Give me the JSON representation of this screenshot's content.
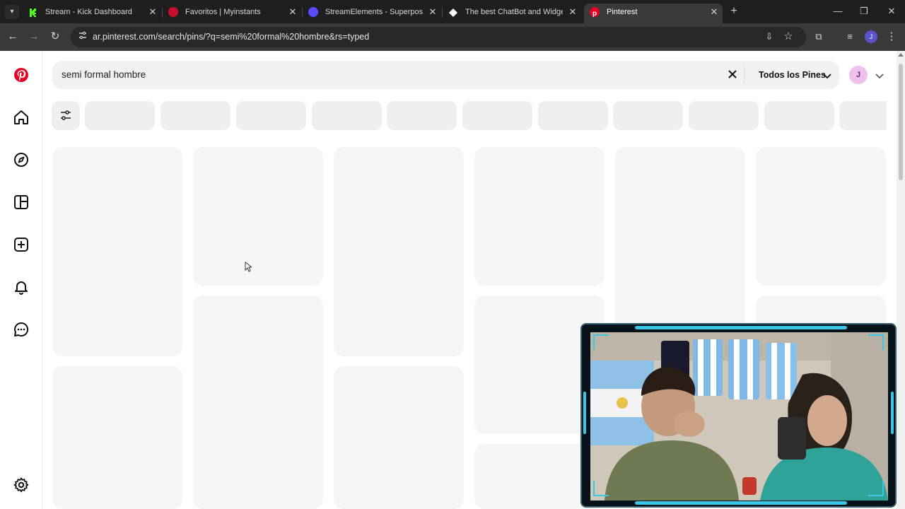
{
  "browser": {
    "tabs": [
      {
        "title": "Stream - Kick Dashboard",
        "favicon_color": "#53fc18",
        "favicon": "kick-logo-icon"
      },
      {
        "title": "Favoritos | Myinstants",
        "favicon_color": "#c8102e",
        "favicon": "myinstants-logo-icon"
      },
      {
        "title": "StreamElements - Superposición",
        "favicon_color": "#5b4bff",
        "favicon": "streamelements-logo-icon"
      },
      {
        "title": "The best ChatBot and Widgets",
        "favicon_color": "#ffffff",
        "favicon": "chatbot-logo-icon"
      },
      {
        "title": "Pinterest",
        "favicon_color": "#e60023",
        "favicon": "pinterest-logo-icon"
      }
    ],
    "active_tab_index": 4,
    "url": "ar.pinterest.com/search/pins/?q=semi%20formal%20hombre&rs=typed",
    "profile_initial": "J"
  },
  "pinterest": {
    "brand_color": "#e60023",
    "search_query": "semi formal hombre",
    "scope_label": "Todos los Pines",
    "avatar_initial": "J",
    "sidebar": [
      {
        "name": "pinterest-logo-icon"
      },
      {
        "name": "home-icon"
      },
      {
        "name": "explore-icon"
      },
      {
        "name": "boards-icon"
      },
      {
        "name": "create-icon"
      },
      {
        "name": "notifications-icon"
      },
      {
        "name": "messages-icon"
      },
      {
        "name": "settings-icon"
      }
    ],
    "filter_chips_loading": 11,
    "pins_state": "loading-placeholders"
  },
  "webcam_overlay": {
    "accent_color": "#3cc6e6"
  }
}
